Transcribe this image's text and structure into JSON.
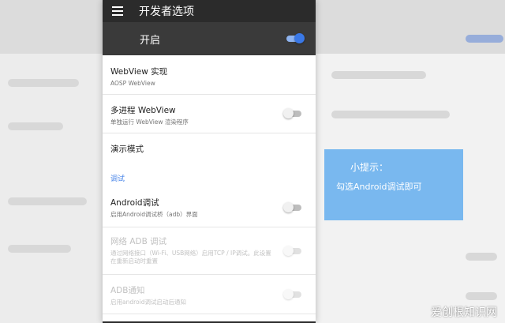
{
  "appbar": {
    "title": "开发者选项"
  },
  "master_switch": {
    "label": "开启",
    "state": "on"
  },
  "settings": [
    {
      "title": "WebView 实现",
      "subtitle": "AOSP WebView"
    },
    {
      "title": "多进程 WebView",
      "subtitle": "单独运行 WebView 渲染程序",
      "switch": "off"
    },
    {
      "title": "演示模式"
    }
  ],
  "section": {
    "label": "调试"
  },
  "debug_settings": [
    {
      "title": "Android调试",
      "subtitle": "启用Android调试桥（adb）界面",
      "switch": "off"
    },
    {
      "title": "网络 ADB 调试",
      "subtitle": "通过网络接口（Wi-Fi、USB网络）启用TCP / IP调试。此设置在重新启动时重置",
      "switch": "off",
      "enabled": false
    },
    {
      "title": "ADB通知",
      "subtitle": "启用android调试启动后通知",
      "switch": "off",
      "enabled": false
    }
  ],
  "tip": {
    "title": "小提示：",
    "text": "勾选Android调试即可"
  },
  "watermark": "爱创根知识网",
  "colors": {
    "appbar": "#2b2b2b",
    "switch_on": "#3a78e6",
    "section": "#4a86e8",
    "tip_bg": "#79b8ef"
  },
  "icons": {
    "menu": "hamburger-menu-icon"
  }
}
